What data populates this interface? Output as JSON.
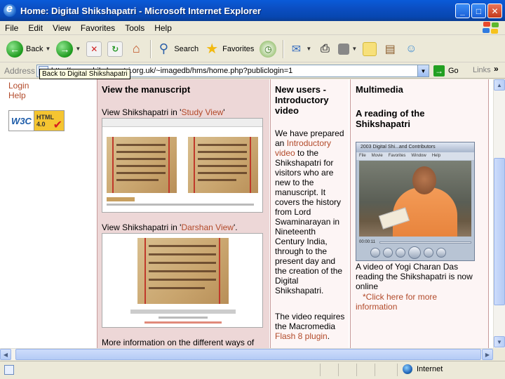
{
  "window": {
    "title": "Home: Digital Shikshapatri - Microsoft Internet Explorer",
    "minimize": "_",
    "maximize": "□",
    "close": "✕"
  },
  "menu": [
    "File",
    "Edit",
    "View",
    "Favorites",
    "Tools",
    "Help"
  ],
  "toolbar": {
    "back": "Back",
    "search": "Search",
    "favorites": "Favorites"
  },
  "address": {
    "label": "Address",
    "url": "http://www.shikshapatri.org.uk/~imagedb/hms/home.php?publiclogin=1",
    "go": "Go",
    "links": "Links",
    "chevron": "»"
  },
  "tooltip": "Back to Digital Shikshapatri",
  "left_nav": {
    "login": "Login",
    "help": "Help",
    "badge_left": "W3C",
    "badge_right_1": "HTML",
    "badge_right_2": "4.0"
  },
  "manuscript": {
    "heading": "View the manuscript",
    "study_prefix": "View Shikshapatri in '",
    "study_link": "Study View",
    "study_suffix": "'",
    "darshan_prefix": "View Shikshapatri in '",
    "darshan_link": "Darshan View",
    "darshan_suffix": "'.",
    "more_info": "More information on the different ways of"
  },
  "video": {
    "heading": "New users - Introductory video",
    "p1_a": "We have prepared an ",
    "p1_link": "Introductory video",
    "p1_b": " to the Shikshapatri for visitors who are new to the manuscript. It covers the history from Lord Swaminarayan in Nineteenth Century India, through to the present day and the creation of the Digital Shikshapatri.",
    "p2_a": "The video requires the Macromedia ",
    "p2_link": "Flash 8 plugin",
    "p2_b": "."
  },
  "multimedia": {
    "heading": "Multimedia",
    "subheading": "A reading of the Shikshapatri",
    "player_title": "2003 Digital Shi...and Contributors",
    "player_menu": [
      "File",
      "Movie",
      "Favorites",
      "Window",
      "Help"
    ],
    "player_time": "00:00:11",
    "caption": "A video of Yogi Charan Das reading the Shikshapatri is now online",
    "link": "*Click here for more information"
  },
  "status": {
    "zone": "Internet"
  },
  "colors": {
    "link": "#b24a2a",
    "manuscript_bg": "#edd7d7",
    "titlebar": "#0b4ec2"
  }
}
